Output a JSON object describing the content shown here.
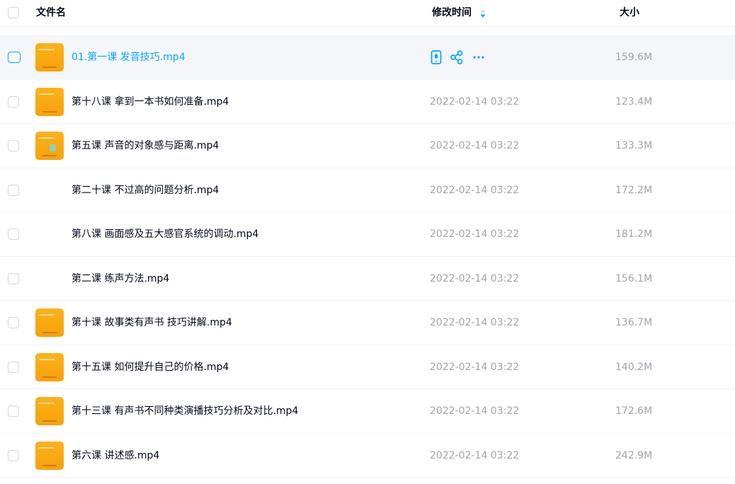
{
  "header": {
    "name_label": "文件名",
    "time_label": "修改时间",
    "size_label": "大小"
  },
  "colors": {
    "accent": "#06a7ff",
    "thumbnail": "#f7a10b",
    "muted_text": "#a0a3ab"
  },
  "rows": [
    {
      "name": "01.第一课 发音技巧.mp4",
      "time": "",
      "size": "159.6M",
      "thumbnail": true
    },
    {
      "name": "第十八课 拿到一本书如何准备.mp4",
      "time": "2022-02-14 03:22",
      "size": "123.4M",
      "thumbnail": true
    },
    {
      "name": "第五课 声音的对象感与距离.mp4",
      "time": "2022-02-14 03:22",
      "size": "133.3M",
      "thumbnail": true
    },
    {
      "name": "第二十课 不过高的问题分析.mp4",
      "time": "2022-02-14 03:22",
      "size": "172.2M",
      "thumbnail": false
    },
    {
      "name": "第八课 画面感及五大感官系统的调动.mp4",
      "time": "2022-02-14 03:22",
      "size": "181.2M",
      "thumbnail": false
    },
    {
      "name": "第二课 练声方法.mp4",
      "time": "2022-02-14 03:22",
      "size": "156.1M",
      "thumbnail": false
    },
    {
      "name": "第十课 故事类有声书 技巧讲解.mp4",
      "time": "2022-02-14 03:22",
      "size": "136.7M",
      "thumbnail": true
    },
    {
      "name": "第十五课 如何提升自己的价格.mp4",
      "time": "2022-02-14 03:22",
      "size": "140.2M",
      "thumbnail": true
    },
    {
      "name": "第十三课 有声书不同种类演播技巧分析及对比.mp4",
      "time": "2022-02-14 03:22",
      "size": "172.6M",
      "thumbnail": true
    },
    {
      "name": "第六课 讲述感.mp4",
      "time": "2022-02-14 03:22",
      "size": "242.9M",
      "thumbnail": true
    }
  ],
  "hover_actions": [
    "phone-icon",
    "share-icon",
    "more-icon"
  ]
}
